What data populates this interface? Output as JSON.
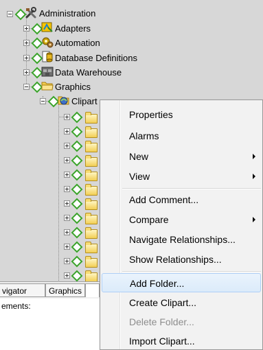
{
  "tree": {
    "nodes": [
      {
        "label": "Administration",
        "icon": "tools-icon"
      },
      {
        "label": "Adapters",
        "icon": "adapter-icon"
      },
      {
        "label": "Automation",
        "icon": "automation-icon"
      },
      {
        "label": "Database Definitions",
        "icon": "database-definitions-icon"
      },
      {
        "label": "Data Warehouse",
        "icon": "data-warehouse-icon"
      },
      {
        "label": "Graphics",
        "icon": "folder-icon"
      },
      {
        "label": "Clipart",
        "icon": "clipart-folder-icon"
      }
    ],
    "folder_rows": 12
  },
  "tabs": {
    "items": [
      {
        "label": "vigator"
      },
      {
        "label": "Graphics"
      }
    ]
  },
  "lower_panel": {
    "label": "ements:"
  },
  "context_menu": {
    "items": [
      {
        "label": "Properties",
        "submenu": false,
        "disabled": false,
        "highlighted": false
      },
      {
        "label": "Alarms",
        "submenu": false,
        "disabled": false,
        "highlighted": false
      },
      {
        "label": "New",
        "submenu": true,
        "disabled": false,
        "highlighted": false
      },
      {
        "label": "View",
        "submenu": true,
        "disabled": false,
        "highlighted": false
      },
      {
        "label": "Add Comment...",
        "submenu": false,
        "disabled": false,
        "highlighted": false
      },
      {
        "label": "Compare",
        "submenu": true,
        "disabled": false,
        "highlighted": false
      },
      {
        "label": "Navigate Relationships...",
        "submenu": false,
        "disabled": false,
        "highlighted": false
      },
      {
        "label": "Show Relationships...",
        "submenu": false,
        "disabled": false,
        "highlighted": false
      },
      {
        "label": "Add Folder...",
        "submenu": false,
        "disabled": false,
        "highlighted": true
      },
      {
        "label": "Create Clipart...",
        "submenu": false,
        "disabled": false,
        "highlighted": false
      },
      {
        "label": "Delete Folder...",
        "submenu": false,
        "disabled": true,
        "highlighted": false
      },
      {
        "label": "Import Clipart...",
        "submenu": false,
        "disabled": false,
        "highlighted": false
      }
    ]
  },
  "colors": {
    "tree_background": "#d7d7d7",
    "menu_background": "#f2f2f2",
    "menu_highlight": "#dbebfa",
    "node_diamond": "#3aa32a",
    "disabled_text": "#8d8d8d"
  }
}
